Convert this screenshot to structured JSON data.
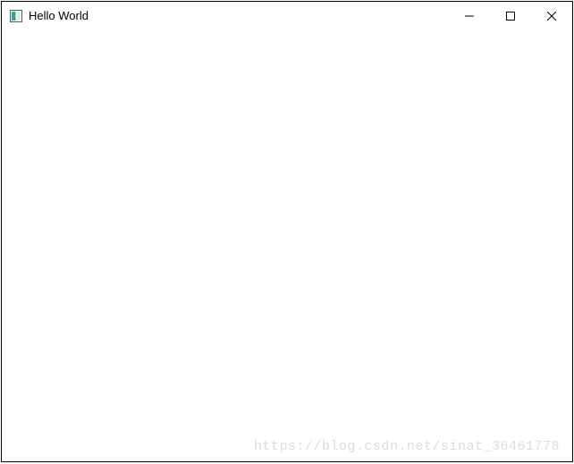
{
  "window": {
    "title": "Hello World"
  },
  "watermark": {
    "text": "https://blog.csdn.net/sinat_36461778"
  }
}
